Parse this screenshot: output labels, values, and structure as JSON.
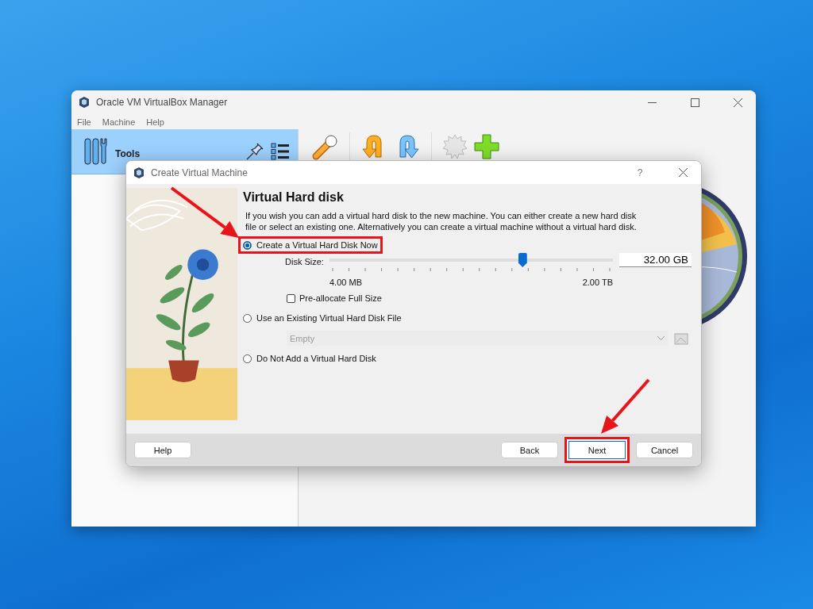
{
  "main_window": {
    "title": "Oracle VM VirtualBox Manager",
    "menu": [
      "File",
      "Machine",
      "Help"
    ],
    "tools_label": "Tools"
  },
  "dialog": {
    "title": "Create Virtual Machine",
    "help_glyph": "?",
    "heading": "Virtual Hard disk",
    "description": "If you wish you can add a virtual hard disk to the new machine. You can either create a new hard disk file or select an existing one. Alternatively you can create a virtual machine without a virtual hard disk.",
    "options": [
      {
        "label": "Create a Virtual Hard Disk Now",
        "selected": true,
        "highlighted": true
      },
      {
        "label": "Use an Existing Virtual Hard Disk File",
        "selected": false,
        "highlighted": false
      },
      {
        "label": "Do Not Add a Virtual Hard Disk",
        "selected": false,
        "highlighted": false
      }
    ],
    "disk_size": {
      "label": "Disk Size:",
      "level": 0.68,
      "value": "32.00 GB",
      "min_label": "4.00 MB",
      "max_label": "2.00 TB"
    },
    "preallocate": {
      "label": "Pre-allocate Full Size",
      "checked": false
    },
    "existing_file": {
      "value": "Empty",
      "disabled": true
    },
    "buttons": [
      {
        "label": "Help",
        "highlighted": false
      },
      {
        "label": "Back",
        "highlighted": false
      },
      {
        "label": "Next",
        "highlighted": true
      },
      {
        "label": "Cancel",
        "highlighted": false
      }
    ]
  }
}
